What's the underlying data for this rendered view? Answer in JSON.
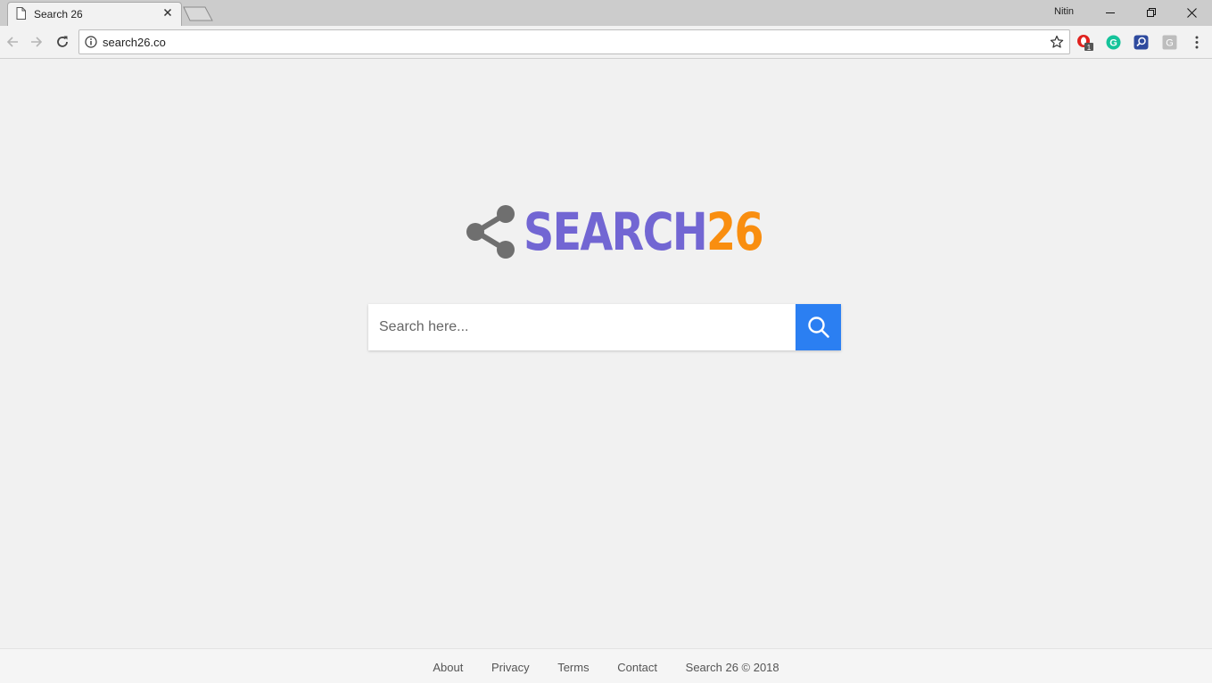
{
  "browser": {
    "tab": {
      "title": "Search 26",
      "icon": "page-icon",
      "close_icon": "close-icon"
    },
    "profile_name": "Nitin",
    "window_controls": [
      "minimize-icon",
      "restore-icon",
      "close-icon"
    ],
    "address_bar": {
      "url": "search26.co",
      "security_icon": "info-icon",
      "bookmark_icon": "star-icon"
    },
    "extensions": [
      {
        "name": "opera-vpn-extension",
        "badge": "1",
        "color": "#e0221e"
      },
      {
        "name": "grammarly-extension",
        "label": "G",
        "color": "#15c39a"
      },
      {
        "name": "search-extension",
        "color": "#2e4a9e"
      },
      {
        "name": "g-extension",
        "label": "G",
        "color": "#bdbdbd"
      }
    ]
  },
  "logo": {
    "word": "SEARCH",
    "number": "26",
    "icon": "share-icon",
    "word_color": "#7266d3",
    "number_color": "#f98e10"
  },
  "search": {
    "placeholder": "Search here...",
    "button_icon": "search-icon",
    "button_color": "#2b7ff2"
  },
  "footer": {
    "links": [
      "About",
      "Privacy",
      "Terms",
      "Contact"
    ],
    "copyright": "Search 26 © 2018"
  }
}
